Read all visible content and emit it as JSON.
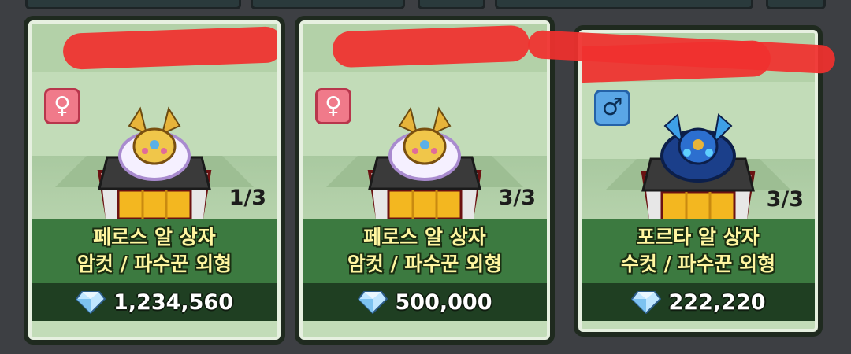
{
  "shop": {
    "cards": [
      {
        "gender": "female",
        "gender_icon": "venus-icon",
        "gender_symbol": "♀",
        "egg_color": "gold-white",
        "count": "1/3",
        "name_line1": "페로스 알 상자",
        "name_line2": "암컷 / 파수꾼 외형",
        "currency_icon": "diamond-icon",
        "price": "1,234,560"
      },
      {
        "gender": "female",
        "gender_icon": "venus-icon",
        "gender_symbol": "♀",
        "egg_color": "gold-white",
        "count": "3/3",
        "name_line1": "페로스 알 상자",
        "name_line2": "암컷 / 파수꾼 외형",
        "currency_icon": "diamond-icon",
        "price": "500,000"
      },
      {
        "gender": "male",
        "gender_icon": "mars-icon",
        "gender_symbol": "♂",
        "egg_color": "blue-navy",
        "count": "3/3",
        "name_line1": "포르타 알 상자",
        "name_line2": "수컷 / 파수꾼 외형",
        "currency_icon": "diamond-icon",
        "price": "222,220"
      }
    ]
  },
  "colors": {
    "card_bg": "#c2dcb8",
    "label_bg": "#3c7a40",
    "price_bg": "#1f3f22",
    "label_text": "#fff6a0",
    "redaction": "#f0302e"
  }
}
